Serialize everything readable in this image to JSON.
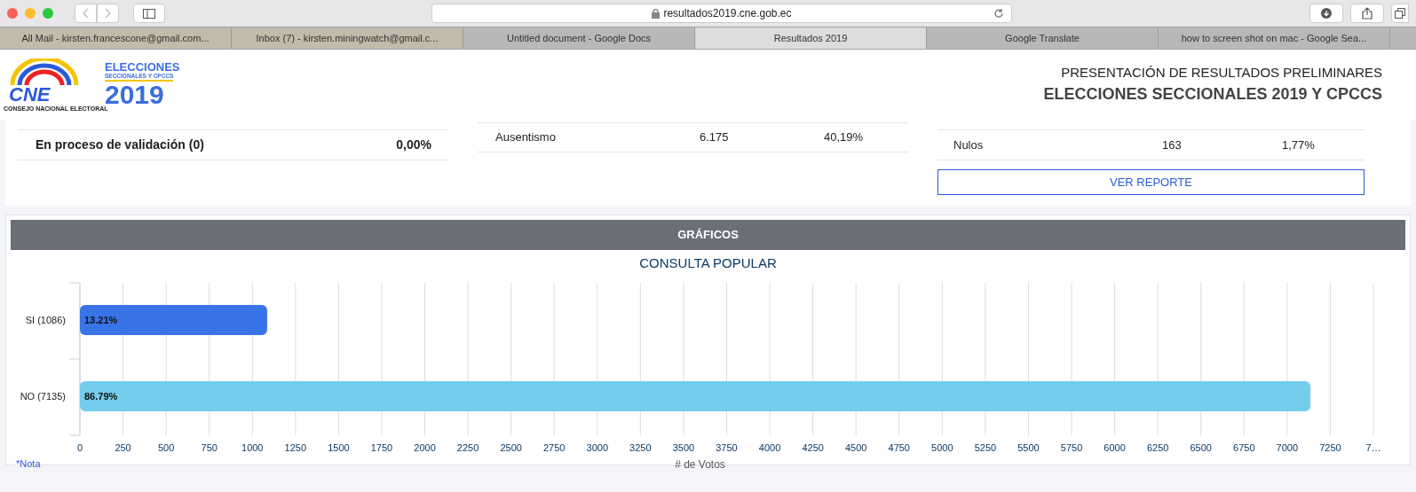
{
  "browser": {
    "url": "resultados2019.cne.gob.ec",
    "tabs": [
      {
        "label": "All Mail - kirsten.francescone@gmail.com...",
        "selected": false
      },
      {
        "label": "Inbox (7) - kirsten.miningwatch@gmail.c...",
        "selected": false
      },
      {
        "label": "Untitled document - Google Docs",
        "selected": false
      },
      {
        "label": "Resultados 2019",
        "selected": true
      },
      {
        "label": "Google Translate",
        "selected": false
      },
      {
        "label": "how to screen shot on mac - Google Sea...",
        "selected": false
      }
    ]
  },
  "header": {
    "logo_cne": "CNE",
    "logo_cne_caption": "CONSEJO NACIONAL ELECTORAL",
    "logo_title": "ELECCIONES",
    "logo_subtitle": "SECCIONALES Y CPCCS",
    "logo_year": "2019",
    "title": "PRESENTACIÓN DE RESULTADOS PRELIMINARES",
    "subtitle": "ELECCIONES SECCIONALES 2019 Y CPCCS"
  },
  "results": {
    "left": [
      {
        "label": "En proceso de validación (0)",
        "percent": "0,00%"
      }
    ],
    "middle": [
      {
        "label": "Ausentismo",
        "count": "6.175",
        "percent": "40,19%"
      }
    ],
    "right": [
      {
        "label": "Nulos",
        "count": "163",
        "percent": "1,77%"
      }
    ],
    "button": "VER REPORTE"
  },
  "graphs": {
    "heading": "GRÁFICOS",
    "note": "*Nota",
    "chart_data": {
      "type": "bar",
      "orientation": "horizontal",
      "title": "CONSULTA POPULAR",
      "xlabel": "# de Votos",
      "categories": [
        "SI (1086)",
        "NO (7135)"
      ],
      "series": [
        {
          "color": "#3874e8",
          "values": [
            1086,
            null
          ]
        },
        {
          "color": "#74cdec",
          "values": [
            null,
            7135
          ]
        }
      ],
      "grid": true,
      "value_labels": [
        "13.21%",
        "86.79%"
      ],
      "xlim": [
        0,
        7500
      ],
      "xticks": [
        0,
        250,
        500,
        750,
        1000,
        1250,
        1500,
        1750,
        2000,
        2250,
        2500,
        2750,
        3000,
        3250,
        3500,
        3750,
        4000,
        4250,
        4500,
        4750,
        5000,
        5250,
        5500,
        5750,
        6000,
        6250,
        6500,
        6750,
        7000,
        7250,
        {
          "value": 7500,
          "label": "7…"
        }
      ]
    }
  }
}
